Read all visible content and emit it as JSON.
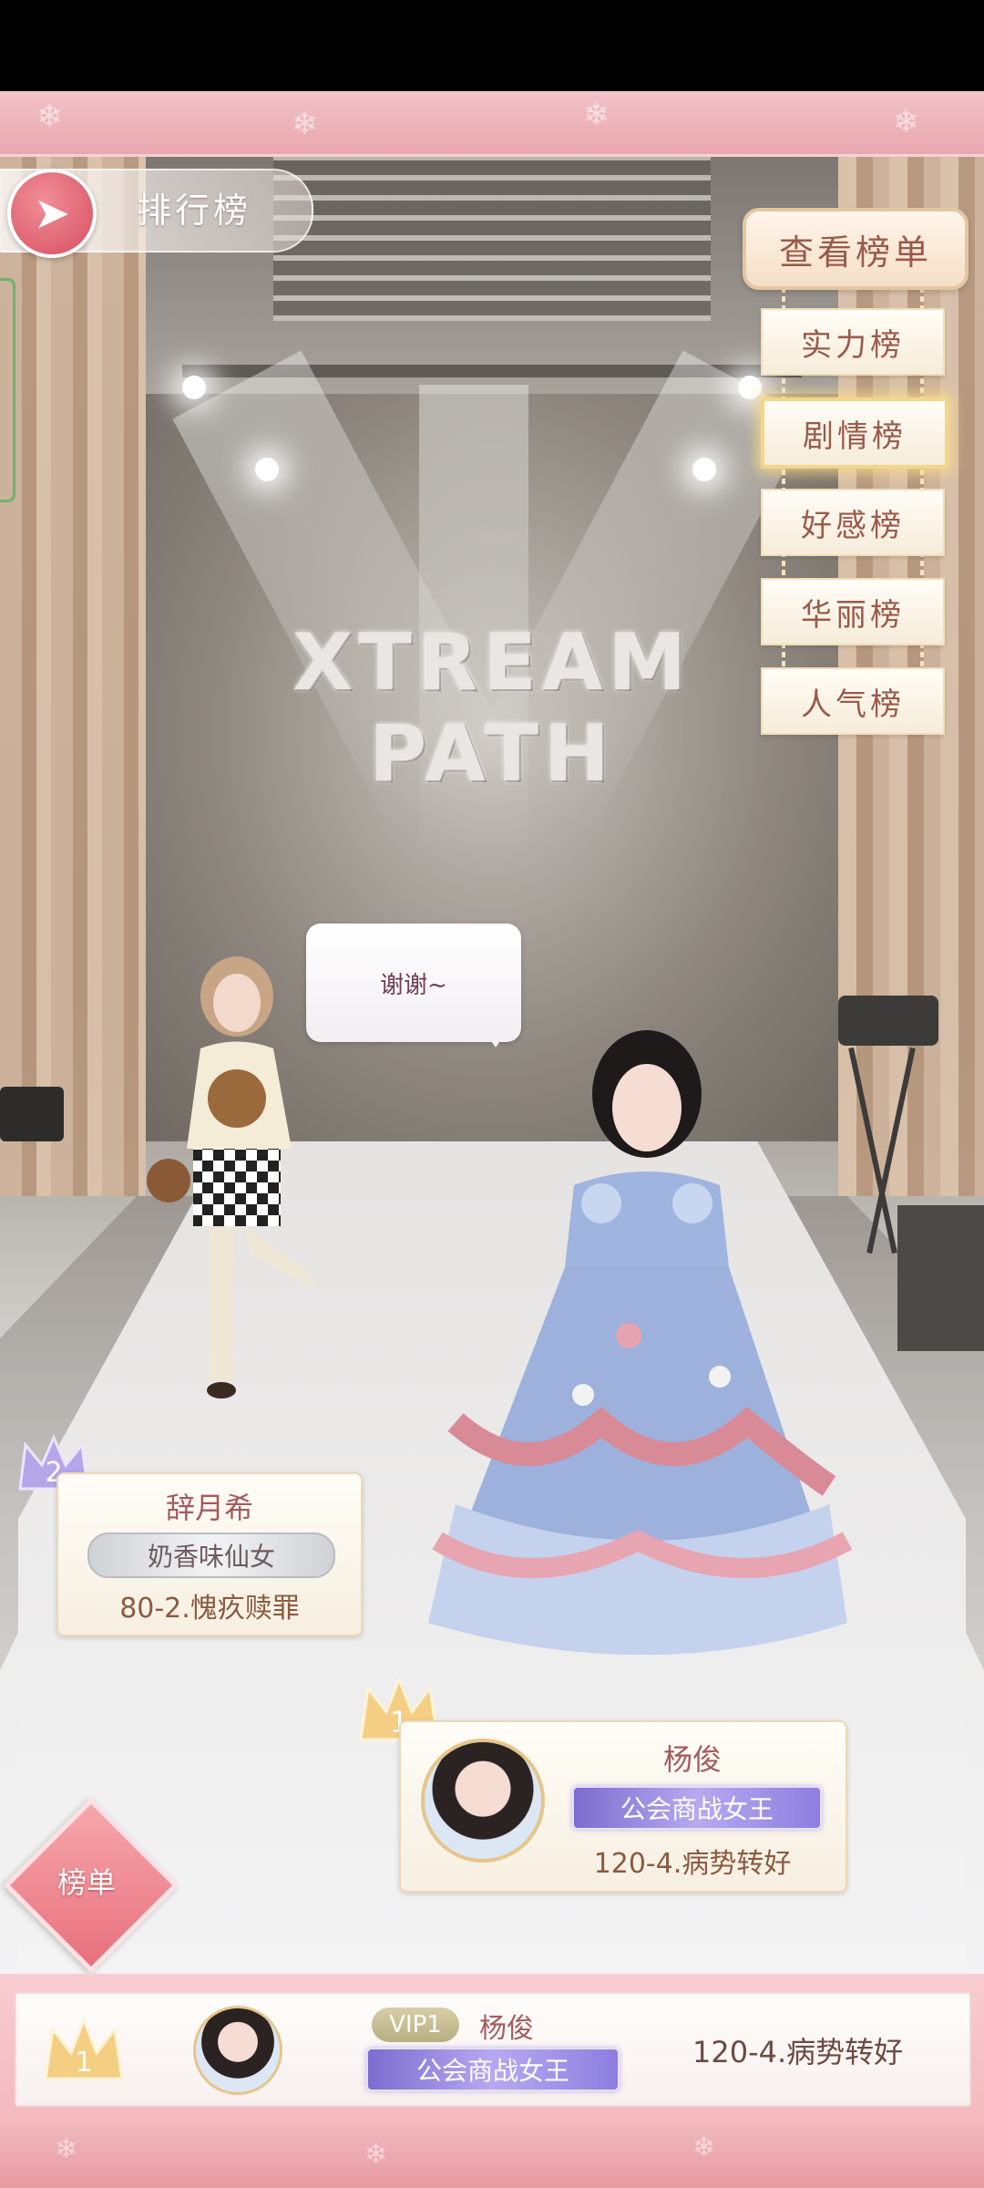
{
  "header": {
    "title": "排行榜"
  },
  "stage": {
    "backdrop_text": "XTREAM PATH"
  },
  "ranking_menu": {
    "view_list_label": "查看榜单",
    "items": [
      {
        "label": "实力榜",
        "active": false
      },
      {
        "label": "剧情榜",
        "active": true
      },
      {
        "label": "好感榜",
        "active": false
      },
      {
        "label": "华丽榜",
        "active": false
      },
      {
        "label": "人气榜",
        "active": false
      }
    ]
  },
  "speech_bubble": {
    "text": "谢谢~"
  },
  "rank_2": {
    "rank": "2",
    "name": "辞月希",
    "title": "奶香味仙女",
    "chapter": "80-2.愧疚赎罪"
  },
  "rank_1": {
    "rank": "1",
    "name": "杨俊",
    "title": "公会商战女王",
    "chapter": "120-4.病势转好"
  },
  "board_button": {
    "label": "榜单"
  },
  "self_entry": {
    "rank": "1",
    "vip": "VIP1",
    "name": "杨俊",
    "title": "公会商战女王",
    "chapter": "120-4.病势转好"
  },
  "colors": {
    "frame_pink": "#eaa5ad",
    "back_button": "#d84f60",
    "card_name": "#a55a5e",
    "guild_title": "#8d7ee0",
    "active_glow": "#f4d68a"
  }
}
